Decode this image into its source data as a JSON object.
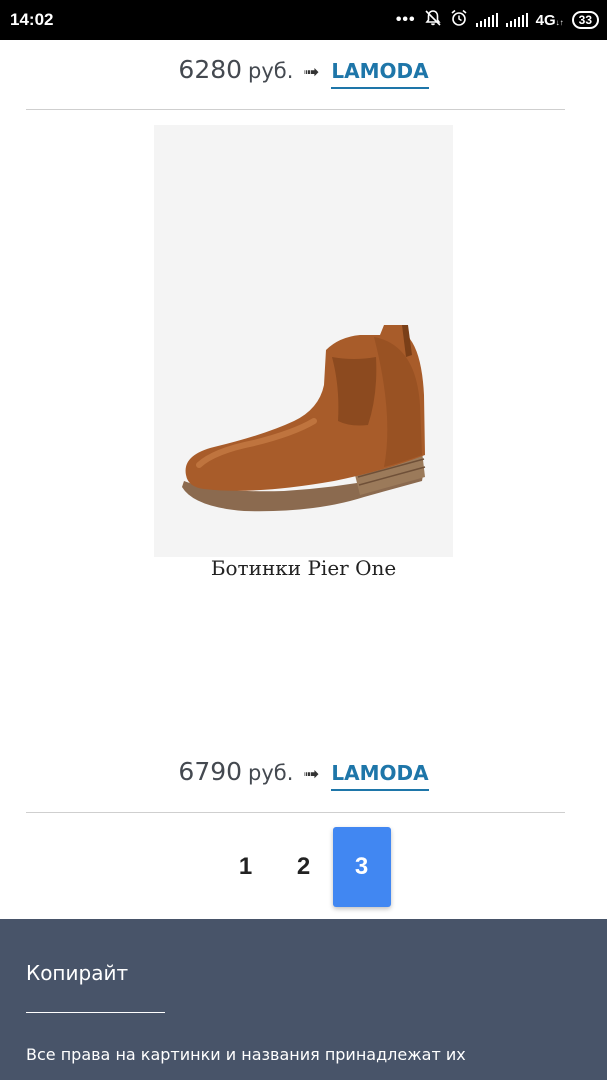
{
  "status_bar": {
    "time": "14:02",
    "network": "4G",
    "battery": "33"
  },
  "offers": [
    {
      "price": "6280",
      "currency": "руб.",
      "arrow": "➟",
      "store": "LAMODA"
    },
    {
      "price": "6790",
      "currency": "руб.",
      "arrow": "➟",
      "store": "LAMODA"
    }
  ],
  "product": {
    "title": "Ботинки Pier One",
    "image_icon": "brown-chelsea-boot"
  },
  "pagination": {
    "pages": [
      "1",
      "2",
      "3"
    ],
    "active": "3"
  },
  "footer": {
    "title": "Копирайт",
    "text": "Все права на картинки и названия принадлежат их"
  },
  "colors": {
    "accent": "#4187f2",
    "link": "#1e76a9",
    "footer_bg": "#485469"
  }
}
